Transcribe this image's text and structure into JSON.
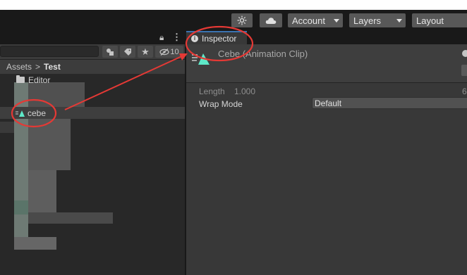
{
  "toolbar": {
    "account_label": "Account",
    "layers_label": "Layers",
    "layout_label": "Layout"
  },
  "project": {
    "count_label": "10",
    "breadcrumb": {
      "root": "Assets",
      "separator": ">",
      "current": "Test"
    },
    "items": [
      {
        "label": "Editor",
        "icon": "folder-icon"
      },
      {
        "label": "cebe",
        "icon": "animation-clip-icon"
      }
    ]
  },
  "inspector": {
    "tab_label": "Inspector",
    "asset_title": "Cebe (Animation Clip)",
    "length_label": "Length",
    "length_value": "1.000",
    "length_right": "6",
    "wrap_mode_label": "Wrap Mode",
    "wrap_mode_value": "Default"
  },
  "colors": {
    "accent": "#3a72b0",
    "annotation": "#e53935",
    "clip_icon": "#5ee8c8"
  }
}
